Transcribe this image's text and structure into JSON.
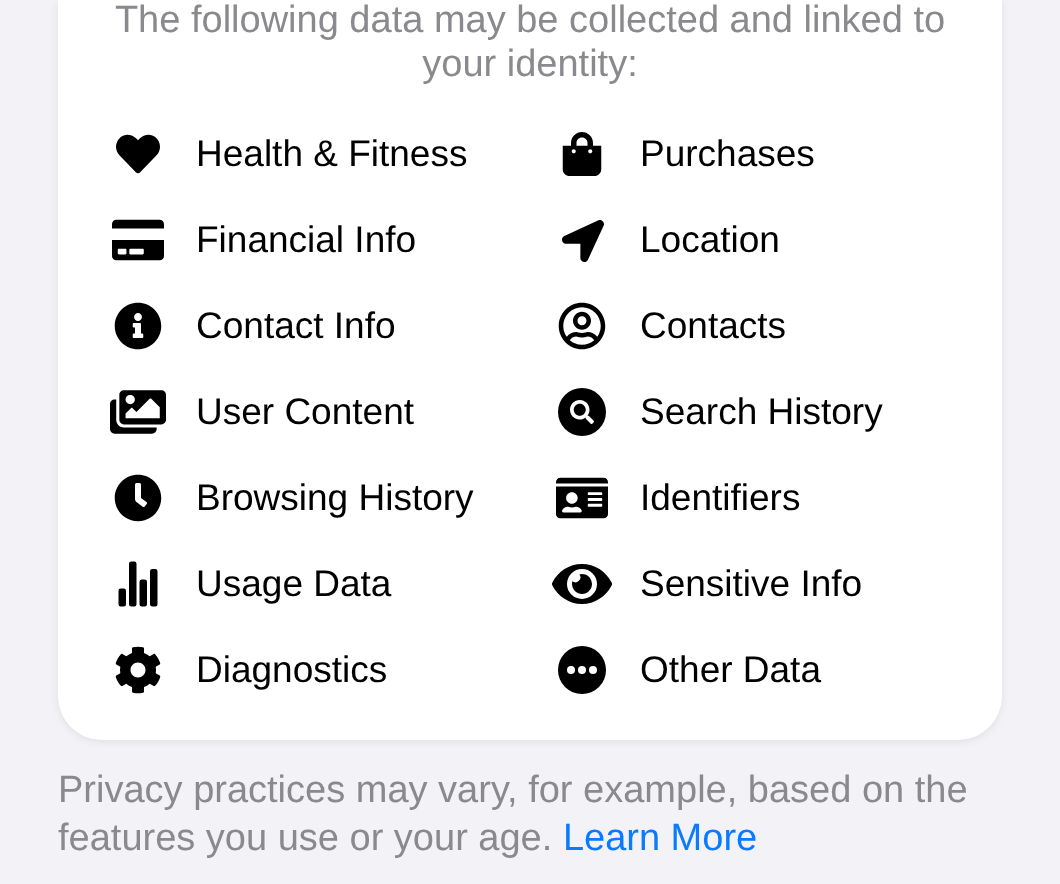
{
  "card": {
    "intro": "The following data may be collected and linked to your identity:",
    "categories": [
      {
        "label": "Health & Fitness"
      },
      {
        "label": "Purchases"
      },
      {
        "label": "Financial Info"
      },
      {
        "label": "Location"
      },
      {
        "label": "Contact Info"
      },
      {
        "label": "Contacts"
      },
      {
        "label": "User Content"
      },
      {
        "label": "Search History"
      },
      {
        "label": "Browsing History"
      },
      {
        "label": "Identifiers"
      },
      {
        "label": "Usage Data"
      },
      {
        "label": "Sensitive Info"
      },
      {
        "label": "Diagnostics"
      },
      {
        "label": "Other Data"
      }
    ]
  },
  "footer": {
    "text": "Privacy practices may vary, for example, based on the features you use or your age.",
    "link": "Learn More"
  }
}
